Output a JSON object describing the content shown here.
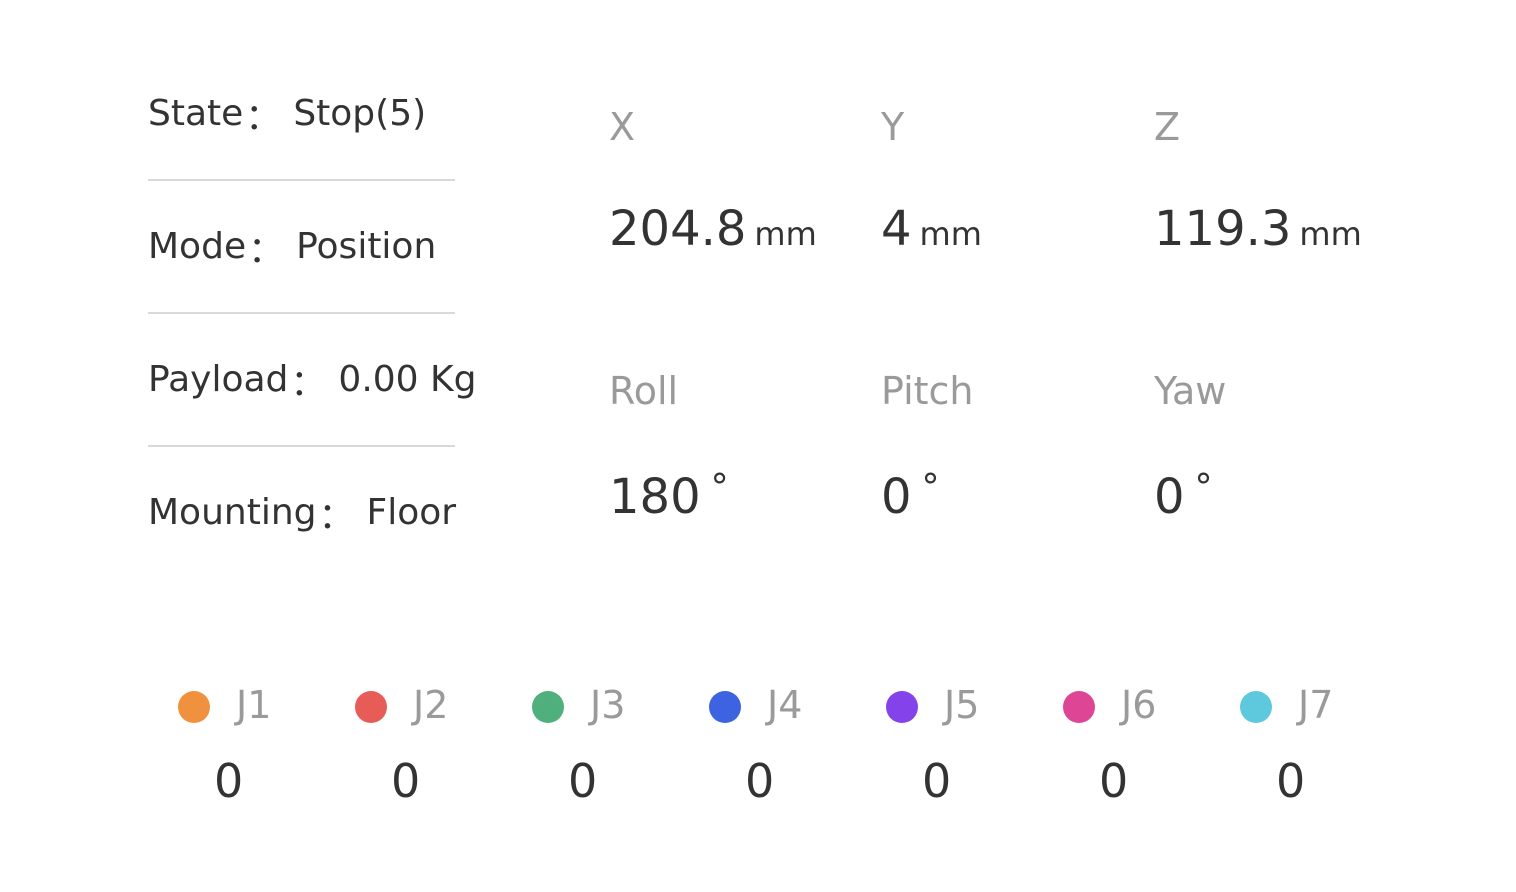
{
  "status": {
    "state": {
      "label": "State",
      "value": "Stop(5)"
    },
    "mode": {
      "label": "Mode",
      "value": "Position"
    },
    "payload": {
      "label": "Payload",
      "value": "0.00 Kg"
    },
    "mounting": {
      "label": "Mounting",
      "value": "Floor"
    },
    "separator": "："
  },
  "pose": {
    "x": {
      "label": "X",
      "value": "204.8",
      "unit": "mm"
    },
    "y": {
      "label": "Y",
      "value": "4",
      "unit": "mm"
    },
    "z": {
      "label": "Z",
      "value": "119.3",
      "unit": "mm"
    },
    "roll": {
      "label": "Roll",
      "value": "180",
      "unit": "°"
    },
    "pitch": {
      "label": "Pitch",
      "value": "0",
      "unit": "°"
    },
    "yaw": {
      "label": "Yaw",
      "value": "0",
      "unit": "°"
    }
  },
  "joints": [
    {
      "label": "J1",
      "value": "0",
      "color": "#f0913f"
    },
    {
      "label": "J2",
      "value": "0",
      "color": "#e85c58"
    },
    {
      "label": "J3",
      "value": "0",
      "color": "#4fb07d"
    },
    {
      "label": "J4",
      "value": "0",
      "color": "#3d63e0"
    },
    {
      "label": "J5",
      "value": "0",
      "color": "#8442ea"
    },
    {
      "label": "J6",
      "value": "0",
      "color": "#de4595"
    },
    {
      "label": "J7",
      "value": "0",
      "color": "#5ec8dc"
    }
  ]
}
